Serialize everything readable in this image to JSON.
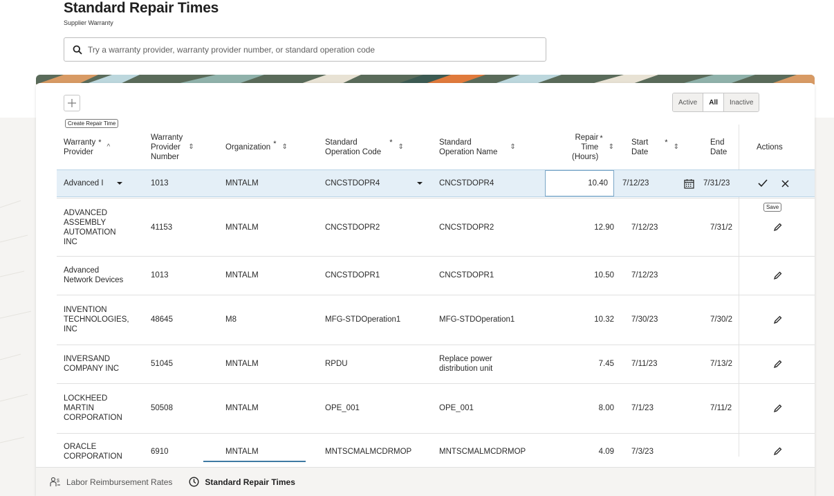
{
  "header": {
    "title": "Standard Repair Times",
    "subtitle": "Supplier Warranty"
  },
  "search": {
    "placeholder": "Try a warranty provider, warranty provider number, or standard operation code"
  },
  "toolbar": {
    "create_tooltip": "Create Repair Time",
    "filters": [
      {
        "label": "Active",
        "selected": false
      },
      {
        "label": "All",
        "selected": true
      },
      {
        "label": "Inactive",
        "selected": false
      }
    ]
  },
  "columns": {
    "provider": {
      "line1": "Warranty",
      "line2": "Provider",
      "required": "*",
      "sort": "^"
    },
    "number": {
      "line1": "Warranty",
      "line2": "Provider",
      "line3": "Number"
    },
    "organization": {
      "line1": "Organization",
      "required": "*"
    },
    "op_code": {
      "line1": "Standard",
      "line2": "Operation Code",
      "required": "*"
    },
    "op_name": {
      "line1": "Standard",
      "line2": "Operation Name"
    },
    "repair_time": {
      "line1": "Repair",
      "line2": "Time",
      "line3": "(Hours)",
      "required": "*"
    },
    "start_date": {
      "line1": "Start",
      "line2": "Date",
      "required": "*"
    },
    "end_date": {
      "line1": "End",
      "line2": "Date"
    },
    "actions": {
      "line1": "Actions"
    }
  },
  "edit_row": {
    "provider": "Advanced I",
    "number": "1013",
    "organization": "MNTALM",
    "op_code": "CNCSTDOPR4",
    "op_name": "CNCSTDOPR4",
    "repair_time": "10.40",
    "start_date": "7/12/23",
    "end_date": "7/31/23",
    "save_tooltip": "Save"
  },
  "rows": [
    {
      "provider": [
        "ADVANCED",
        "ASSEMBLY",
        "AUTOMATION",
        "INC"
      ],
      "number": "41153",
      "organization": "MNTALM",
      "op_code": "CNCSTDOPR2",
      "op_name": [
        "CNCSTDOPR2"
      ],
      "repair_time": "12.90",
      "start_date": "7/12/23",
      "end_date": "7/31/2"
    },
    {
      "provider": [
        "Advanced",
        "Network Devices"
      ],
      "number": "1013",
      "organization": "MNTALM",
      "op_code": "CNCSTDOPR1",
      "op_name": [
        "CNCSTDOPR1"
      ],
      "repair_time": "10.50",
      "start_date": "7/12/23",
      "end_date": ""
    },
    {
      "provider": [
        "INVENTION",
        "TECHNOLOGIES,",
        "INC"
      ],
      "number": "48645",
      "organization": "M8",
      "op_code": "MFG-STDOperation1",
      "op_name": [
        "MFG-STDOperation1"
      ],
      "repair_time": "10.32",
      "start_date": "7/30/23",
      "end_date": "7/30/2"
    },
    {
      "provider": [
        "INVERSAND",
        "COMPANY INC"
      ],
      "number": "51045",
      "organization": "MNTALM",
      "op_code": "RPDU",
      "op_name": [
        "Replace power",
        "distribution unit"
      ],
      "repair_time": "7.45",
      "start_date": "7/11/23",
      "end_date": "7/13/2"
    },
    {
      "provider": [
        "LOCKHEED",
        "MARTIN",
        "CORPORATION"
      ],
      "number": "50508",
      "organization": "MNTALM",
      "op_code": "OPE_001",
      "op_name": [
        "OPE_001"
      ],
      "repair_time": "8.00",
      "start_date": "7/1/23",
      "end_date": "7/11/2"
    },
    {
      "provider": [
        "ORACLE",
        "CORPORATION"
      ],
      "number": "6910",
      "organization": "MNTALM",
      "op_code": "MNTSCMALMCDRMOP",
      "op_name": [
        "MNTSCMALMCDRMOP"
      ],
      "repair_time": "4.09",
      "start_date": "7/3/23",
      "end_date": ""
    }
  ],
  "tabs": [
    {
      "label": "Labor Reimbursement Rates",
      "icon": "labor-rates-icon",
      "active": false
    },
    {
      "label": "Standard Repair Times",
      "icon": "clock-icon",
      "active": true
    }
  ],
  "colors": {
    "accent": "#3f7aa3",
    "edit_row_bg": "#e4eff7",
    "page_bg": "#f5f4f2"
  }
}
